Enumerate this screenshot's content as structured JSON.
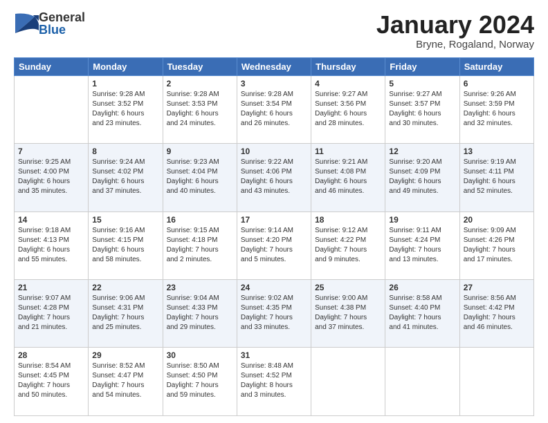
{
  "logo": {
    "general": "General",
    "blue": "Blue"
  },
  "header": {
    "month": "January 2024",
    "location": "Bryne, Rogaland, Norway"
  },
  "weekdays": [
    "Sunday",
    "Monday",
    "Tuesday",
    "Wednesday",
    "Thursday",
    "Friday",
    "Saturday"
  ],
  "weeks": [
    [
      {
        "day": "",
        "info": ""
      },
      {
        "day": "1",
        "info": "Sunrise: 9:28 AM\nSunset: 3:52 PM\nDaylight: 6 hours\nand 23 minutes."
      },
      {
        "day": "2",
        "info": "Sunrise: 9:28 AM\nSunset: 3:53 PM\nDaylight: 6 hours\nand 24 minutes."
      },
      {
        "day": "3",
        "info": "Sunrise: 9:28 AM\nSunset: 3:54 PM\nDaylight: 6 hours\nand 26 minutes."
      },
      {
        "day": "4",
        "info": "Sunrise: 9:27 AM\nSunset: 3:56 PM\nDaylight: 6 hours\nand 28 minutes."
      },
      {
        "day": "5",
        "info": "Sunrise: 9:27 AM\nSunset: 3:57 PM\nDaylight: 6 hours\nand 30 minutes."
      },
      {
        "day": "6",
        "info": "Sunrise: 9:26 AM\nSunset: 3:59 PM\nDaylight: 6 hours\nand 32 minutes."
      }
    ],
    [
      {
        "day": "7",
        "info": "Sunrise: 9:25 AM\nSunset: 4:00 PM\nDaylight: 6 hours\nand 35 minutes."
      },
      {
        "day": "8",
        "info": "Sunrise: 9:24 AM\nSunset: 4:02 PM\nDaylight: 6 hours\nand 37 minutes."
      },
      {
        "day": "9",
        "info": "Sunrise: 9:23 AM\nSunset: 4:04 PM\nDaylight: 6 hours\nand 40 minutes."
      },
      {
        "day": "10",
        "info": "Sunrise: 9:22 AM\nSunset: 4:06 PM\nDaylight: 6 hours\nand 43 minutes."
      },
      {
        "day": "11",
        "info": "Sunrise: 9:21 AM\nSunset: 4:08 PM\nDaylight: 6 hours\nand 46 minutes."
      },
      {
        "day": "12",
        "info": "Sunrise: 9:20 AM\nSunset: 4:09 PM\nDaylight: 6 hours\nand 49 minutes."
      },
      {
        "day": "13",
        "info": "Sunrise: 9:19 AM\nSunset: 4:11 PM\nDaylight: 6 hours\nand 52 minutes."
      }
    ],
    [
      {
        "day": "14",
        "info": "Sunrise: 9:18 AM\nSunset: 4:13 PM\nDaylight: 6 hours\nand 55 minutes."
      },
      {
        "day": "15",
        "info": "Sunrise: 9:16 AM\nSunset: 4:15 PM\nDaylight: 6 hours\nand 58 minutes."
      },
      {
        "day": "16",
        "info": "Sunrise: 9:15 AM\nSunset: 4:18 PM\nDaylight: 7 hours\nand 2 minutes."
      },
      {
        "day": "17",
        "info": "Sunrise: 9:14 AM\nSunset: 4:20 PM\nDaylight: 7 hours\nand 5 minutes."
      },
      {
        "day": "18",
        "info": "Sunrise: 9:12 AM\nSunset: 4:22 PM\nDaylight: 7 hours\nand 9 minutes."
      },
      {
        "day": "19",
        "info": "Sunrise: 9:11 AM\nSunset: 4:24 PM\nDaylight: 7 hours\nand 13 minutes."
      },
      {
        "day": "20",
        "info": "Sunrise: 9:09 AM\nSunset: 4:26 PM\nDaylight: 7 hours\nand 17 minutes."
      }
    ],
    [
      {
        "day": "21",
        "info": "Sunrise: 9:07 AM\nSunset: 4:28 PM\nDaylight: 7 hours\nand 21 minutes."
      },
      {
        "day": "22",
        "info": "Sunrise: 9:06 AM\nSunset: 4:31 PM\nDaylight: 7 hours\nand 25 minutes."
      },
      {
        "day": "23",
        "info": "Sunrise: 9:04 AM\nSunset: 4:33 PM\nDaylight: 7 hours\nand 29 minutes."
      },
      {
        "day": "24",
        "info": "Sunrise: 9:02 AM\nSunset: 4:35 PM\nDaylight: 7 hours\nand 33 minutes."
      },
      {
        "day": "25",
        "info": "Sunrise: 9:00 AM\nSunset: 4:38 PM\nDaylight: 7 hours\nand 37 minutes."
      },
      {
        "day": "26",
        "info": "Sunrise: 8:58 AM\nSunset: 4:40 PM\nDaylight: 7 hours\nand 41 minutes."
      },
      {
        "day": "27",
        "info": "Sunrise: 8:56 AM\nSunset: 4:42 PM\nDaylight: 7 hours\nand 46 minutes."
      }
    ],
    [
      {
        "day": "28",
        "info": "Sunrise: 8:54 AM\nSunset: 4:45 PM\nDaylight: 7 hours\nand 50 minutes."
      },
      {
        "day": "29",
        "info": "Sunrise: 8:52 AM\nSunset: 4:47 PM\nDaylight: 7 hours\nand 54 minutes."
      },
      {
        "day": "30",
        "info": "Sunrise: 8:50 AM\nSunset: 4:50 PM\nDaylight: 7 hours\nand 59 minutes."
      },
      {
        "day": "31",
        "info": "Sunrise: 8:48 AM\nSunset: 4:52 PM\nDaylight: 8 hours\nand 3 minutes."
      },
      {
        "day": "",
        "info": ""
      },
      {
        "day": "",
        "info": ""
      },
      {
        "day": "",
        "info": ""
      }
    ]
  ]
}
